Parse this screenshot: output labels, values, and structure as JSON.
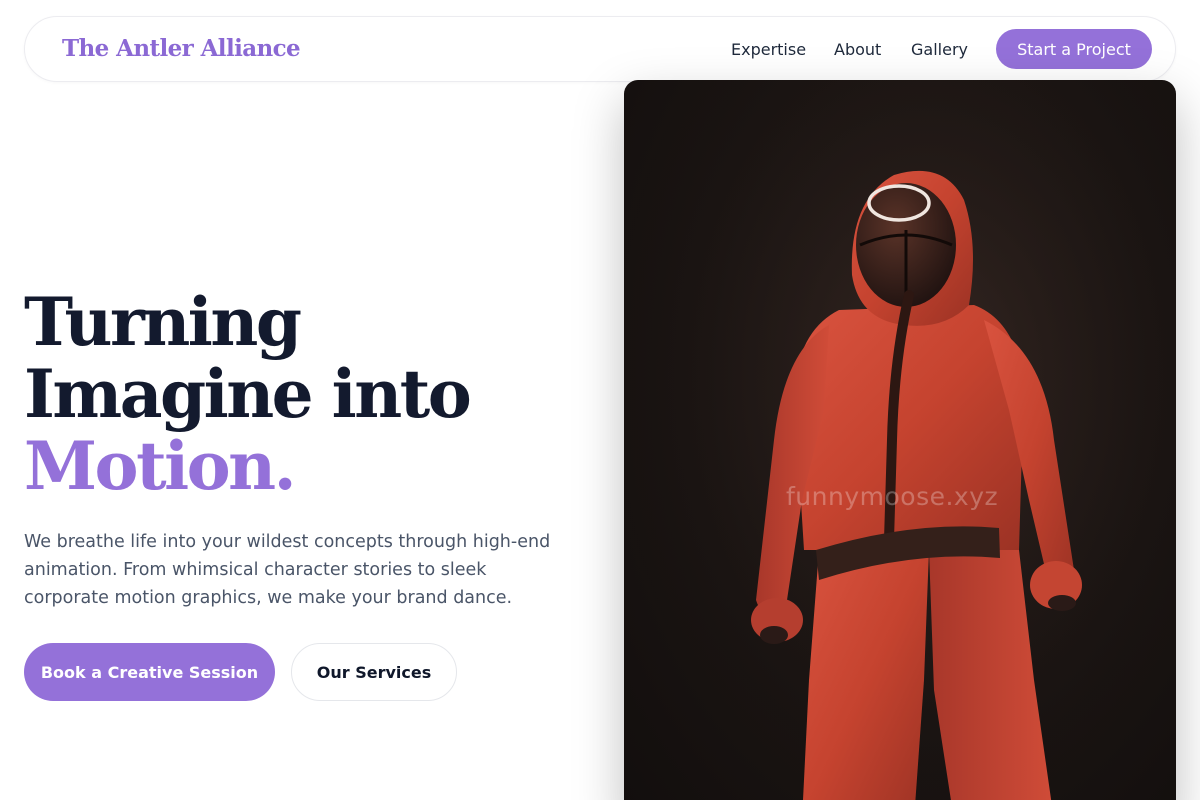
{
  "header": {
    "brand": "The Antler Alliance",
    "nav": [
      {
        "label": "Expertise"
      },
      {
        "label": "About"
      },
      {
        "label": "Gallery"
      }
    ],
    "cta_label": "Start a Project"
  },
  "hero": {
    "title_line1": "Turning",
    "title_line2": "Imagine into",
    "title_accent": "Motion.",
    "description": "We breathe life into your wildest concepts through high-end animation. From whimsical character stories to sleek corporate motion graphics, we make your brand dance.",
    "primary_button": "Book a Creative Session",
    "secondary_button": "Our Services",
    "image": {
      "subject": "3D character in red jumpsuit with black masked hood",
      "watermark": "funnymoose.xyz"
    }
  },
  "colors": {
    "accent": "#9471d9",
    "brand_text": "#8b69d4",
    "heading": "#131a2e",
    "body_text": "#4a5568",
    "suit_red": "#c8473a",
    "image_bg": "#1a1412"
  }
}
